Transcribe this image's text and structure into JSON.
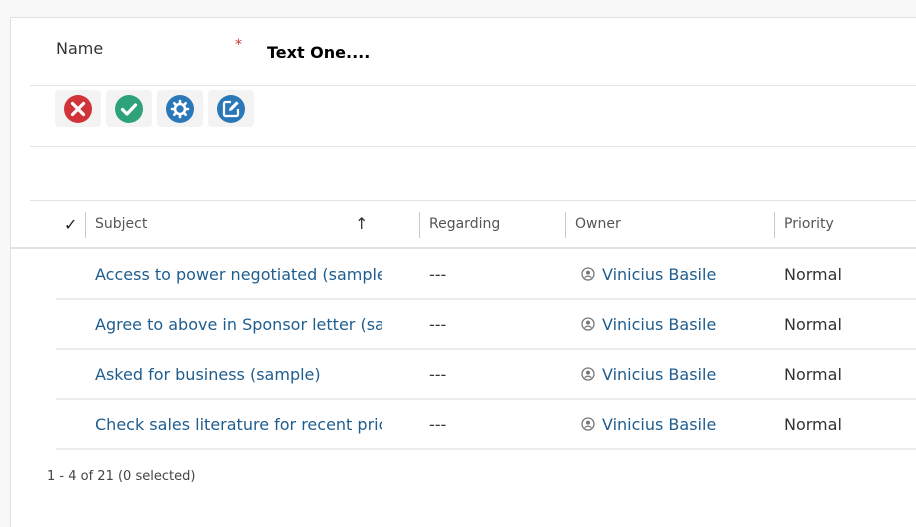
{
  "form": {
    "name_label": "Name",
    "required_marker": "*",
    "name_value": "Text One...."
  },
  "toolbar": {
    "buttons": [
      {
        "icon": "close-circle-icon",
        "color": "#d13438"
      },
      {
        "icon": "check-circle-icon",
        "color": "#2ea37a"
      },
      {
        "icon": "gear-circle-icon",
        "color": "#2b78b8"
      },
      {
        "icon": "edit-circle-icon",
        "color": "#2b78b8"
      }
    ]
  },
  "grid": {
    "check_symbol": "✓",
    "sort_symbol": "↑",
    "columns": [
      "Subject",
      "Regarding",
      "Owner",
      "Priority"
    ],
    "rows": [
      {
        "subject": "Access to power negotiated (sample)",
        "regarding": "---",
        "owner": "Vinicius Basile",
        "priority": "Normal"
      },
      {
        "subject": "Agree to above in Sponsor letter (sample).",
        "regarding": "---",
        "owner": "Vinicius Basile",
        "priority": "Normal"
      },
      {
        "subject": "Asked for business (sample)",
        "regarding": "---",
        "owner": "Vinicius Basile",
        "priority": "Normal"
      },
      {
        "subject": "Check sales literature for recent price list (sample)",
        "regarding": "---",
        "owner": "Vinicius Basile",
        "priority": "Normal"
      }
    ],
    "footer": "1 - 4 of 21 (0 selected)"
  }
}
